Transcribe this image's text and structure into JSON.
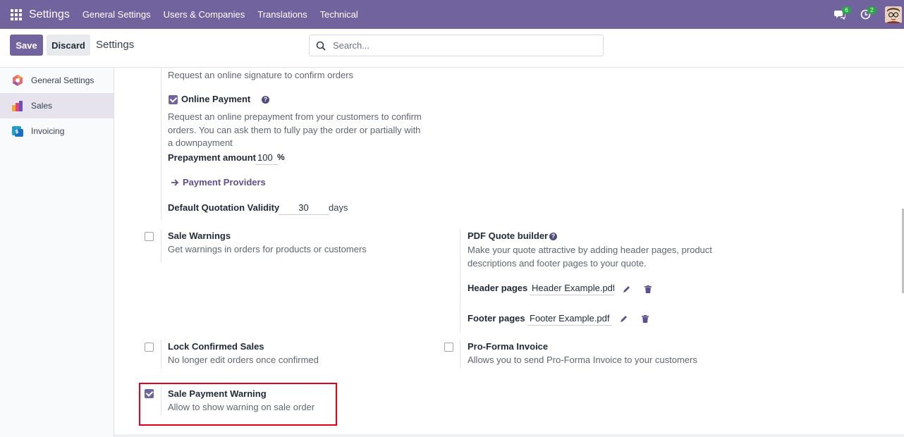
{
  "navbar": {
    "brand": "Settings",
    "menu": [
      "General Settings",
      "Users & Companies",
      "Translations",
      "Technical"
    ],
    "messages_badge": "6",
    "activities_badge": "2"
  },
  "control": {
    "save_label": "Save",
    "discard_label": "Discard",
    "title": "Settings",
    "search_placeholder": "Search..."
  },
  "sidebar": {
    "items": [
      {
        "label": "General Settings"
      },
      {
        "label": "Sales"
      },
      {
        "label": "Invoicing"
      }
    ]
  },
  "settings": {
    "signature_desc": "Request an online signature to confirm orders",
    "online_payment": {
      "label": "Online Payment",
      "desc_lines": [
        "Request an online prepayment from your customers to confirm",
        "orders. You can ask them to fully pay the order or partially with",
        "a downpayment"
      ],
      "prepayment_label": "Prepayment amount",
      "prepayment_value": "100",
      "prepayment_unit": "%",
      "providers_link": "Payment Providers",
      "validity_label": "Default Quotation Validity",
      "validity_value": "30",
      "validity_unit": "days"
    },
    "sale_warnings": {
      "label": "Sale Warnings",
      "desc": "Get warnings in orders for products or customers"
    },
    "pdf_quote": {
      "label": "PDF Quote builder",
      "desc_lines": [
        "Make your quote attractive by adding header pages, product",
        "descriptions and footer pages to your quote."
      ],
      "header_label": "Header pages",
      "header_value": "Header Example.pdf",
      "footer_label": "Footer pages",
      "footer_value": "Footer Example.pdf"
    },
    "lock_confirmed": {
      "label": "Lock Confirmed Sales",
      "desc": "No longer edit orders once confirmed"
    },
    "proforma": {
      "label": "Pro-Forma Invoice",
      "desc": "Allows you to send Pro-Forma Invoice to your customers"
    },
    "sale_payment_warning": {
      "label": "Sale Payment Warning",
      "desc": "Allow to show warning on sale order"
    }
  },
  "colors": {
    "brand": "#71639e",
    "highlight": "#e3001b"
  }
}
